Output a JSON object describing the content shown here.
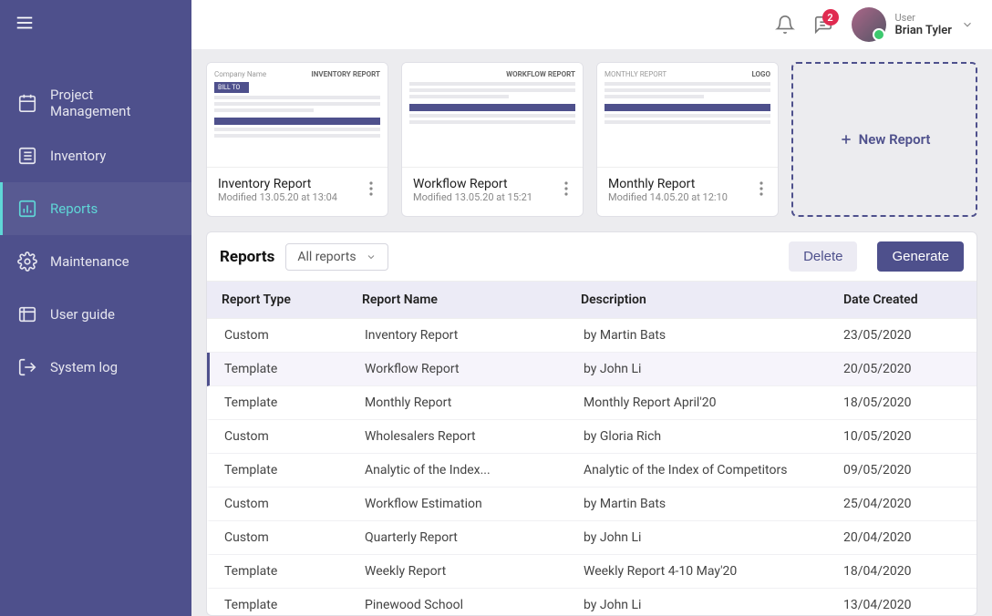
{
  "sidebar": {
    "items": [
      {
        "label": "Project Management",
        "icon": "calendar"
      },
      {
        "label": "Inventory",
        "icon": "list"
      },
      {
        "label": "Reports",
        "icon": "chart",
        "active": true
      },
      {
        "label": "Maintenance",
        "icon": "gear"
      },
      {
        "label": "User guide",
        "icon": "book"
      },
      {
        "label": "System log",
        "icon": "logout"
      }
    ]
  },
  "topbar": {
    "notifications_badge": "2",
    "user_role": "User",
    "user_name": "Brian Tyler"
  },
  "cards": [
    {
      "title": "Inventory Report",
      "modified": "Modified 13.05.20 at 13:04",
      "thumb_label_l": "Company Name",
      "thumb_label_r": "INVENTORY REPORT"
    },
    {
      "title": "Workflow Report",
      "modified": "Modified 13.05.20 at 15:21",
      "thumb_label_l": "",
      "thumb_label_r": "WORKFLOW REPORT"
    },
    {
      "title": "Monthly Report",
      "modified": "Modified 14.05.20 at 12:10",
      "thumb_label_l": "MONTHLY REPORT",
      "thumb_label_r": "LOGO"
    }
  ],
  "new_report_label": "New Report",
  "panel": {
    "title": "Reports",
    "filter_label": "All reports",
    "delete_label": "Delete",
    "generate_label": "Generate",
    "columns": {
      "type": "Report Type",
      "name": "Report Name",
      "desc": "Description",
      "date": "Date Created"
    },
    "rows": [
      {
        "type": "Custom",
        "name": "Inventory Report",
        "desc": "by Martin Bats",
        "date": "23/05/2020"
      },
      {
        "type": "Template",
        "name": "Workflow Report",
        "desc": "by John Li",
        "date": "20/05/2020",
        "selected": true
      },
      {
        "type": "Template",
        "name": "Monthly Report",
        "desc": "Monthly Report April'20",
        "date": "18/05/2020"
      },
      {
        "type": "Custom",
        "name": "Wholesalers Report",
        "desc": "by Gloria Rich",
        "date": "10/05/2020"
      },
      {
        "type": "Template",
        "name": "Analytic of the Index...",
        "desc": "Analytic of the Index of Competitors",
        "date": "09/05/2020"
      },
      {
        "type": "Custom",
        "name": "Workflow Estimation",
        "desc": "by Martin Bats",
        "date": "25/04/2020"
      },
      {
        "type": "Custom",
        "name": "Quarterly Report",
        "desc": "by John Li",
        "date": "20/04/2020"
      },
      {
        "type": "Template",
        "name": "Weekly Report",
        "desc": "Weekly Report 4-10 May'20",
        "date": "18/04/2020"
      },
      {
        "type": "Template",
        "name": "Pinewood School",
        "desc": "by John Li",
        "date": "13/04/2020"
      }
    ]
  }
}
